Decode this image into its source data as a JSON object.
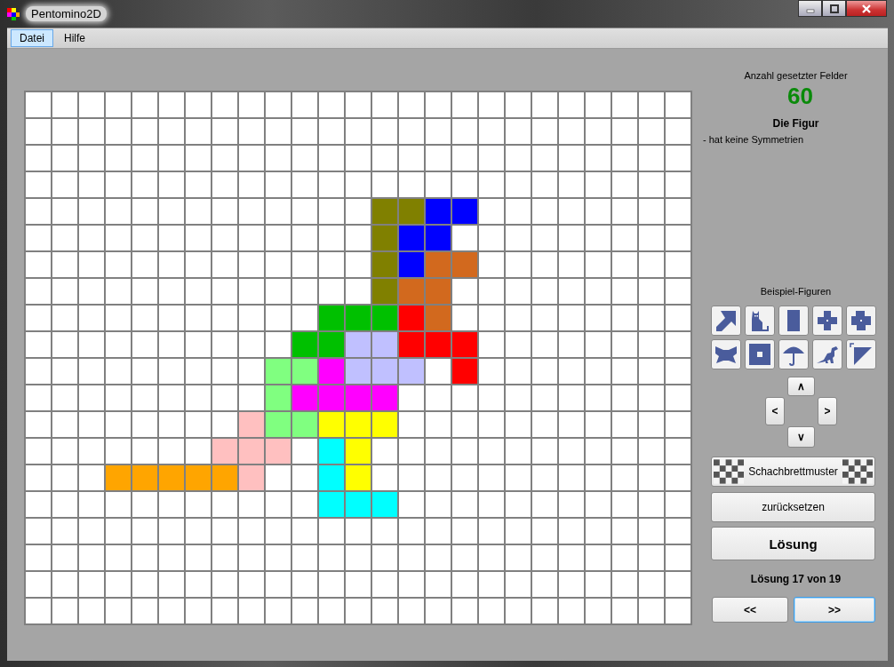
{
  "window": {
    "title": "Pentomino2D"
  },
  "menu": [
    {
      "label": "Datei",
      "selected": true
    },
    {
      "label": "Hilfe",
      "selected": false
    }
  ],
  "board": {
    "rows": [
      {
        "cells": [
          {
            "color": "#ffffff"
          },
          {
            "color": "#ffffff"
          },
          {
            "color": "#ffffff"
          },
          {
            "color": "#ffffff"
          },
          {
            "color": "#ffffff"
          },
          {
            "color": "#ffffff"
          },
          {
            "color": "#ffffff"
          },
          {
            "color": "#ffffff"
          },
          {
            "color": "#ffffff"
          },
          {
            "color": "#ffffff"
          },
          {
            "color": "#ffffff"
          },
          {
            "color": "#ffffff"
          },
          {
            "color": "#ffffff"
          },
          {
            "color": "#ffffff"
          },
          {
            "color": "#ffffff"
          },
          {
            "color": "#ffffff"
          },
          {
            "color": "#ffffff"
          },
          {
            "color": "#ffffff"
          },
          {
            "color": "#ffffff"
          },
          {
            "color": "#ffffff"
          },
          {
            "color": "#ffffff"
          },
          {
            "color": "#ffffff"
          },
          {
            "color": "#ffffff"
          },
          {
            "color": "#ffffff"
          },
          {
            "color": "#ffffff"
          }
        ]
      },
      {
        "cells": [
          {
            "color": "#ffffff"
          },
          {
            "color": "#ffffff"
          },
          {
            "color": "#ffffff"
          },
          {
            "color": "#ffffff"
          },
          {
            "color": "#ffffff"
          },
          {
            "color": "#ffffff"
          },
          {
            "color": "#ffffff"
          },
          {
            "color": "#ffffff"
          },
          {
            "color": "#ffffff"
          },
          {
            "color": "#ffffff"
          },
          {
            "color": "#ffffff"
          },
          {
            "color": "#ffffff"
          },
          {
            "color": "#ffffff"
          },
          {
            "color": "#ffffff"
          },
          {
            "color": "#ffffff"
          },
          {
            "color": "#ffffff"
          },
          {
            "color": "#ffffff"
          },
          {
            "color": "#ffffff"
          },
          {
            "color": "#ffffff"
          },
          {
            "color": "#ffffff"
          },
          {
            "color": "#ffffff"
          },
          {
            "color": "#ffffff"
          },
          {
            "color": "#ffffff"
          },
          {
            "color": "#ffffff"
          },
          {
            "color": "#ffffff"
          }
        ]
      },
      {
        "cells": [
          {
            "color": "#ffffff"
          },
          {
            "color": "#ffffff"
          },
          {
            "color": "#ffffff"
          },
          {
            "color": "#ffffff"
          },
          {
            "color": "#ffffff"
          },
          {
            "color": "#ffffff"
          },
          {
            "color": "#ffffff"
          },
          {
            "color": "#ffffff"
          },
          {
            "color": "#ffffff"
          },
          {
            "color": "#ffffff"
          },
          {
            "color": "#ffffff"
          },
          {
            "color": "#ffffff"
          },
          {
            "color": "#ffffff"
          },
          {
            "color": "#ffffff"
          },
          {
            "color": "#ffffff"
          },
          {
            "color": "#ffffff"
          },
          {
            "color": "#ffffff"
          },
          {
            "color": "#ffffff"
          },
          {
            "color": "#ffffff"
          },
          {
            "color": "#ffffff"
          },
          {
            "color": "#ffffff"
          },
          {
            "color": "#ffffff"
          },
          {
            "color": "#ffffff"
          },
          {
            "color": "#ffffff"
          },
          {
            "color": "#ffffff"
          }
        ]
      },
      {
        "cells": [
          {
            "color": "#ffffff"
          },
          {
            "color": "#ffffff"
          },
          {
            "color": "#ffffff"
          },
          {
            "color": "#ffffff"
          },
          {
            "color": "#ffffff"
          },
          {
            "color": "#ffffff"
          },
          {
            "color": "#ffffff"
          },
          {
            "color": "#ffffff"
          },
          {
            "color": "#ffffff"
          },
          {
            "color": "#ffffff"
          },
          {
            "color": "#ffffff"
          },
          {
            "color": "#ffffff"
          },
          {
            "color": "#ffffff"
          },
          {
            "color": "#ffffff"
          },
          {
            "color": "#ffffff"
          },
          {
            "color": "#ffffff"
          },
          {
            "color": "#ffffff"
          },
          {
            "color": "#ffffff"
          },
          {
            "color": "#ffffff"
          },
          {
            "color": "#ffffff"
          },
          {
            "color": "#ffffff"
          },
          {
            "color": "#ffffff"
          },
          {
            "color": "#ffffff"
          },
          {
            "color": "#ffffff"
          },
          {
            "color": "#ffffff"
          }
        ]
      },
      {
        "cells": [
          {
            "color": "#ffffff"
          },
          {
            "color": "#ffffff"
          },
          {
            "color": "#ffffff"
          },
          {
            "color": "#ffffff"
          },
          {
            "color": "#ffffff"
          },
          {
            "color": "#ffffff"
          },
          {
            "color": "#ffffff"
          },
          {
            "color": "#ffffff"
          },
          {
            "color": "#ffffff"
          },
          {
            "color": "#ffffff"
          },
          {
            "color": "#ffffff"
          },
          {
            "color": "#ffffff"
          },
          {
            "color": "#ffffff"
          },
          {
            "color": "#808000"
          },
          {
            "color": "#808000"
          },
          {
            "color": "#0000ff"
          },
          {
            "color": "#0000ff"
          },
          {
            "color": "#ffffff"
          },
          {
            "color": "#ffffff"
          },
          {
            "color": "#ffffff"
          },
          {
            "color": "#ffffff"
          },
          {
            "color": "#ffffff"
          },
          {
            "color": "#ffffff"
          },
          {
            "color": "#ffffff"
          },
          {
            "color": "#ffffff"
          }
        ]
      },
      {
        "cells": [
          {
            "color": "#ffffff"
          },
          {
            "color": "#ffffff"
          },
          {
            "color": "#ffffff"
          },
          {
            "color": "#ffffff"
          },
          {
            "color": "#ffffff"
          },
          {
            "color": "#ffffff"
          },
          {
            "color": "#ffffff"
          },
          {
            "color": "#ffffff"
          },
          {
            "color": "#ffffff"
          },
          {
            "color": "#ffffff"
          },
          {
            "color": "#ffffff"
          },
          {
            "color": "#ffffff"
          },
          {
            "color": "#ffffff"
          },
          {
            "color": "#808000"
          },
          {
            "color": "#0000ff"
          },
          {
            "color": "#0000ff"
          },
          {
            "color": "#ffffff"
          },
          {
            "color": "#ffffff"
          },
          {
            "color": "#ffffff"
          },
          {
            "color": "#ffffff"
          },
          {
            "color": "#ffffff"
          },
          {
            "color": "#ffffff"
          },
          {
            "color": "#ffffff"
          },
          {
            "color": "#ffffff"
          },
          {
            "color": "#ffffff"
          }
        ]
      },
      {
        "cells": [
          {
            "color": "#ffffff"
          },
          {
            "color": "#ffffff"
          },
          {
            "color": "#ffffff"
          },
          {
            "color": "#ffffff"
          },
          {
            "color": "#ffffff"
          },
          {
            "color": "#ffffff"
          },
          {
            "color": "#ffffff"
          },
          {
            "color": "#ffffff"
          },
          {
            "color": "#ffffff"
          },
          {
            "color": "#ffffff"
          },
          {
            "color": "#ffffff"
          },
          {
            "color": "#ffffff"
          },
          {
            "color": "#ffffff"
          },
          {
            "color": "#808000"
          },
          {
            "color": "#0000ff"
          },
          {
            "color": "#d2691e"
          },
          {
            "color": "#d2691e"
          },
          {
            "color": "#ffffff"
          },
          {
            "color": "#ffffff"
          },
          {
            "color": "#ffffff"
          },
          {
            "color": "#ffffff"
          },
          {
            "color": "#ffffff"
          },
          {
            "color": "#ffffff"
          },
          {
            "color": "#ffffff"
          },
          {
            "color": "#ffffff"
          }
        ]
      },
      {
        "cells": [
          {
            "color": "#ffffff"
          },
          {
            "color": "#ffffff"
          },
          {
            "color": "#ffffff"
          },
          {
            "color": "#ffffff"
          },
          {
            "color": "#ffffff"
          },
          {
            "color": "#ffffff"
          },
          {
            "color": "#ffffff"
          },
          {
            "color": "#ffffff"
          },
          {
            "color": "#ffffff"
          },
          {
            "color": "#ffffff"
          },
          {
            "color": "#ffffff"
          },
          {
            "color": "#ffffff"
          },
          {
            "color": "#ffffff"
          },
          {
            "color": "#808000"
          },
          {
            "color": "#d2691e"
          },
          {
            "color": "#d2691e"
          },
          {
            "color": "#ffffff"
          },
          {
            "color": "#ffffff"
          },
          {
            "color": "#ffffff"
          },
          {
            "color": "#ffffff"
          },
          {
            "color": "#ffffff"
          },
          {
            "color": "#ffffff"
          },
          {
            "color": "#ffffff"
          },
          {
            "color": "#ffffff"
          },
          {
            "color": "#ffffff"
          }
        ]
      },
      {
        "cells": [
          {
            "color": "#ffffff"
          },
          {
            "color": "#ffffff"
          },
          {
            "color": "#ffffff"
          },
          {
            "color": "#ffffff"
          },
          {
            "color": "#ffffff"
          },
          {
            "color": "#ffffff"
          },
          {
            "color": "#ffffff"
          },
          {
            "color": "#ffffff"
          },
          {
            "color": "#ffffff"
          },
          {
            "color": "#ffffff"
          },
          {
            "color": "#ffffff"
          },
          {
            "color": "#00c000"
          },
          {
            "color": "#00c000"
          },
          {
            "color": "#00c000"
          },
          {
            "color": "#ff0000"
          },
          {
            "color": "#d2691e"
          },
          {
            "color": "#ffffff"
          },
          {
            "color": "#ffffff"
          },
          {
            "color": "#ffffff"
          },
          {
            "color": "#ffffff"
          },
          {
            "color": "#ffffff"
          },
          {
            "color": "#ffffff"
          },
          {
            "color": "#ffffff"
          },
          {
            "color": "#ffffff"
          },
          {
            "color": "#ffffff"
          }
        ]
      },
      {
        "cells": [
          {
            "color": "#ffffff"
          },
          {
            "color": "#ffffff"
          },
          {
            "color": "#ffffff"
          },
          {
            "color": "#ffffff"
          },
          {
            "color": "#ffffff"
          },
          {
            "color": "#ffffff"
          },
          {
            "color": "#ffffff"
          },
          {
            "color": "#ffffff"
          },
          {
            "color": "#ffffff"
          },
          {
            "color": "#ffffff"
          },
          {
            "color": "#00c000"
          },
          {
            "color": "#00c000"
          },
          {
            "color": "#c0c0ff"
          },
          {
            "color": "#c0c0ff"
          },
          {
            "color": "#ff0000"
          },
          {
            "color": "#ff0000"
          },
          {
            "color": "#ff0000"
          },
          {
            "color": "#ffffff"
          },
          {
            "color": "#ffffff"
          },
          {
            "color": "#ffffff"
          },
          {
            "color": "#ffffff"
          },
          {
            "color": "#ffffff"
          },
          {
            "color": "#ffffff"
          },
          {
            "color": "#ffffff"
          },
          {
            "color": "#ffffff"
          }
        ]
      },
      {
        "cells": [
          {
            "color": "#ffffff"
          },
          {
            "color": "#ffffff"
          },
          {
            "color": "#ffffff"
          },
          {
            "color": "#ffffff"
          },
          {
            "color": "#ffffff"
          },
          {
            "color": "#ffffff"
          },
          {
            "color": "#ffffff"
          },
          {
            "color": "#ffffff"
          },
          {
            "color": "#ffffff"
          },
          {
            "color": "#80ff80"
          },
          {
            "color": "#80ff80"
          },
          {
            "color": "#ff00ff"
          },
          {
            "color": "#c0c0ff"
          },
          {
            "color": "#c0c0ff"
          },
          {
            "color": "#c0c0ff"
          },
          {
            "color": "#ffffff"
          },
          {
            "color": "#ff0000"
          },
          {
            "color": "#ffffff"
          },
          {
            "color": "#ffffff"
          },
          {
            "color": "#ffffff"
          },
          {
            "color": "#ffffff"
          },
          {
            "color": "#ffffff"
          },
          {
            "color": "#ffffff"
          },
          {
            "color": "#ffffff"
          },
          {
            "color": "#ffffff"
          }
        ]
      },
      {
        "cells": [
          {
            "color": "#ffffff"
          },
          {
            "color": "#ffffff"
          },
          {
            "color": "#ffffff"
          },
          {
            "color": "#ffffff"
          },
          {
            "color": "#ffffff"
          },
          {
            "color": "#ffffff"
          },
          {
            "color": "#ffffff"
          },
          {
            "color": "#ffffff"
          },
          {
            "color": "#ffffff"
          },
          {
            "color": "#80ff80"
          },
          {
            "color": "#ff00ff"
          },
          {
            "color": "#ff00ff"
          },
          {
            "color": "#ff00ff"
          },
          {
            "color": "#ff00ff"
          },
          {
            "color": "#ffffff"
          },
          {
            "color": "#ffffff"
          },
          {
            "color": "#ffffff"
          },
          {
            "color": "#ffffff"
          },
          {
            "color": "#ffffff"
          },
          {
            "color": "#ffffff"
          },
          {
            "color": "#ffffff"
          },
          {
            "color": "#ffffff"
          },
          {
            "color": "#ffffff"
          },
          {
            "color": "#ffffff"
          },
          {
            "color": "#ffffff"
          }
        ]
      },
      {
        "cells": [
          {
            "color": "#ffffff"
          },
          {
            "color": "#ffffff"
          },
          {
            "color": "#ffffff"
          },
          {
            "color": "#ffffff"
          },
          {
            "color": "#ffffff"
          },
          {
            "color": "#ffffff"
          },
          {
            "color": "#ffffff"
          },
          {
            "color": "#ffffff"
          },
          {
            "color": "#ffc0c0"
          },
          {
            "color": "#80ff80"
          },
          {
            "color": "#80ff80"
          },
          {
            "color": "#ffff00"
          },
          {
            "color": "#ffff00"
          },
          {
            "color": "#ffff00"
          },
          {
            "color": "#ffffff"
          },
          {
            "color": "#ffffff"
          },
          {
            "color": "#ffffff"
          },
          {
            "color": "#ffffff"
          },
          {
            "color": "#ffffff"
          },
          {
            "color": "#ffffff"
          },
          {
            "color": "#ffffff"
          },
          {
            "color": "#ffffff"
          },
          {
            "color": "#ffffff"
          },
          {
            "color": "#ffffff"
          },
          {
            "color": "#ffffff"
          }
        ]
      },
      {
        "cells": [
          {
            "color": "#ffffff"
          },
          {
            "color": "#ffffff"
          },
          {
            "color": "#ffffff"
          },
          {
            "color": "#ffffff"
          },
          {
            "color": "#ffffff"
          },
          {
            "color": "#ffffff"
          },
          {
            "color": "#ffffff"
          },
          {
            "color": "#ffc0c0"
          },
          {
            "color": "#ffc0c0"
          },
          {
            "color": "#ffc0c0"
          },
          {
            "color": "#ffffff"
          },
          {
            "color": "#00ffff"
          },
          {
            "color": "#ffff00"
          },
          {
            "color": "#ffffff"
          },
          {
            "color": "#ffffff"
          },
          {
            "color": "#ffffff"
          },
          {
            "color": "#ffffff"
          },
          {
            "color": "#ffffff"
          },
          {
            "color": "#ffffff"
          },
          {
            "color": "#ffffff"
          },
          {
            "color": "#ffffff"
          },
          {
            "color": "#ffffff"
          },
          {
            "color": "#ffffff"
          },
          {
            "color": "#ffffff"
          },
          {
            "color": "#ffffff"
          }
        ]
      },
      {
        "cells": [
          {
            "color": "#ffffff"
          },
          {
            "color": "#ffffff"
          },
          {
            "color": "#ffffff"
          },
          {
            "color": "#ffa500"
          },
          {
            "color": "#ffa500"
          },
          {
            "color": "#ffa500"
          },
          {
            "color": "#ffa500"
          },
          {
            "color": "#ffa500"
          },
          {
            "color": "#ffc0c0"
          },
          {
            "color": "#ffffff"
          },
          {
            "color": "#ffffff"
          },
          {
            "color": "#00ffff"
          },
          {
            "color": "#ffff00"
          },
          {
            "color": "#ffffff"
          },
          {
            "color": "#ffffff"
          },
          {
            "color": "#ffffff"
          },
          {
            "color": "#ffffff"
          },
          {
            "color": "#ffffff"
          },
          {
            "color": "#ffffff"
          },
          {
            "color": "#ffffff"
          },
          {
            "color": "#ffffff"
          },
          {
            "color": "#ffffff"
          },
          {
            "color": "#ffffff"
          },
          {
            "color": "#ffffff"
          },
          {
            "color": "#ffffff"
          }
        ]
      },
      {
        "cells": [
          {
            "color": "#ffffff"
          },
          {
            "color": "#ffffff"
          },
          {
            "color": "#ffffff"
          },
          {
            "color": "#ffffff"
          },
          {
            "color": "#ffffff"
          },
          {
            "color": "#ffffff"
          },
          {
            "color": "#ffffff"
          },
          {
            "color": "#ffffff"
          },
          {
            "color": "#ffffff"
          },
          {
            "color": "#ffffff"
          },
          {
            "color": "#ffffff"
          },
          {
            "color": "#00ffff"
          },
          {
            "color": "#00ffff"
          },
          {
            "color": "#00ffff"
          },
          {
            "color": "#ffffff"
          },
          {
            "color": "#ffffff"
          },
          {
            "color": "#ffffff"
          },
          {
            "color": "#ffffff"
          },
          {
            "color": "#ffffff"
          },
          {
            "color": "#ffffff"
          },
          {
            "color": "#ffffff"
          },
          {
            "color": "#ffffff"
          },
          {
            "color": "#ffffff"
          },
          {
            "color": "#ffffff"
          },
          {
            "color": "#ffffff"
          }
        ]
      },
      {
        "cells": [
          {
            "color": "#ffffff"
          },
          {
            "color": "#ffffff"
          },
          {
            "color": "#ffffff"
          },
          {
            "color": "#ffffff"
          },
          {
            "color": "#ffffff"
          },
          {
            "color": "#ffffff"
          },
          {
            "color": "#ffffff"
          },
          {
            "color": "#ffffff"
          },
          {
            "color": "#ffffff"
          },
          {
            "color": "#ffffff"
          },
          {
            "color": "#ffffff"
          },
          {
            "color": "#ffffff"
          },
          {
            "color": "#ffffff"
          },
          {
            "color": "#ffffff"
          },
          {
            "color": "#ffffff"
          },
          {
            "color": "#ffffff"
          },
          {
            "color": "#ffffff"
          },
          {
            "color": "#ffffff"
          },
          {
            "color": "#ffffff"
          },
          {
            "color": "#ffffff"
          },
          {
            "color": "#ffffff"
          },
          {
            "color": "#ffffff"
          },
          {
            "color": "#ffffff"
          },
          {
            "color": "#ffffff"
          },
          {
            "color": "#ffffff"
          }
        ]
      },
      {
        "cells": [
          {
            "color": "#ffffff"
          },
          {
            "color": "#ffffff"
          },
          {
            "color": "#ffffff"
          },
          {
            "color": "#ffffff"
          },
          {
            "color": "#ffffff"
          },
          {
            "color": "#ffffff"
          },
          {
            "color": "#ffffff"
          },
          {
            "color": "#ffffff"
          },
          {
            "color": "#ffffff"
          },
          {
            "color": "#ffffff"
          },
          {
            "color": "#ffffff"
          },
          {
            "color": "#ffffff"
          },
          {
            "color": "#ffffff"
          },
          {
            "color": "#ffffff"
          },
          {
            "color": "#ffffff"
          },
          {
            "color": "#ffffff"
          },
          {
            "color": "#ffffff"
          },
          {
            "color": "#ffffff"
          },
          {
            "color": "#ffffff"
          },
          {
            "color": "#ffffff"
          },
          {
            "color": "#ffffff"
          },
          {
            "color": "#ffffff"
          },
          {
            "color": "#ffffff"
          },
          {
            "color": "#ffffff"
          },
          {
            "color": "#ffffff"
          }
        ]
      },
      {
        "cells": [
          {
            "color": "#ffffff"
          },
          {
            "color": "#ffffff"
          },
          {
            "color": "#ffffff"
          },
          {
            "color": "#ffffff"
          },
          {
            "color": "#ffffff"
          },
          {
            "color": "#ffffff"
          },
          {
            "color": "#ffffff"
          },
          {
            "color": "#ffffff"
          },
          {
            "color": "#ffffff"
          },
          {
            "color": "#ffffff"
          },
          {
            "color": "#ffffff"
          },
          {
            "color": "#ffffff"
          },
          {
            "color": "#ffffff"
          },
          {
            "color": "#ffffff"
          },
          {
            "color": "#ffffff"
          },
          {
            "color": "#ffffff"
          },
          {
            "color": "#ffffff"
          },
          {
            "color": "#ffffff"
          },
          {
            "color": "#ffffff"
          },
          {
            "color": "#ffffff"
          },
          {
            "color": "#ffffff"
          },
          {
            "color": "#ffffff"
          },
          {
            "color": "#ffffff"
          },
          {
            "color": "#ffffff"
          },
          {
            "color": "#ffffff"
          }
        ]
      },
      {
        "cells": [
          {
            "color": "#ffffff"
          },
          {
            "color": "#ffffff"
          },
          {
            "color": "#ffffff"
          },
          {
            "color": "#ffffff"
          },
          {
            "color": "#ffffff"
          },
          {
            "color": "#ffffff"
          },
          {
            "color": "#ffffff"
          },
          {
            "color": "#ffffff"
          },
          {
            "color": "#ffffff"
          },
          {
            "color": "#ffffff"
          },
          {
            "color": "#ffffff"
          },
          {
            "color": "#ffffff"
          },
          {
            "color": "#ffffff"
          },
          {
            "color": "#ffffff"
          },
          {
            "color": "#ffffff"
          },
          {
            "color": "#ffffff"
          },
          {
            "color": "#ffffff"
          },
          {
            "color": "#ffffff"
          },
          {
            "color": "#ffffff"
          },
          {
            "color": "#ffffff"
          },
          {
            "color": "#ffffff"
          },
          {
            "color": "#ffffff"
          },
          {
            "color": "#ffffff"
          },
          {
            "color": "#ffffff"
          },
          {
            "color": "#ffffff"
          }
        ]
      }
    ]
  },
  "panel": {
    "count_label": "Anzahl gesetzter Felder",
    "count": "60",
    "figure_heading": "Die Figur",
    "figure_notes": [
      "- hat keine Symmetrien"
    ],
    "examples_label": "Beispiel-Figuren",
    "shift_buttons": [
      {
        "kind": "up",
        "label": "∧"
      },
      {
        "kind": "left",
        "label": "<"
      },
      {
        "kind": "right",
        "label": ">"
      },
      {
        "kind": "down",
        "label": "∨"
      }
    ],
    "checkerboard_button": "Schachbrettmuster",
    "reset_button": "zurücksetzen",
    "solution_button": "Lösung",
    "solution_status": "Lösung 17 von 19",
    "nav_buttons": [
      {
        "label": "<<",
        "focused": false
      },
      {
        "label": ">>",
        "focused": true
      }
    ]
  }
}
